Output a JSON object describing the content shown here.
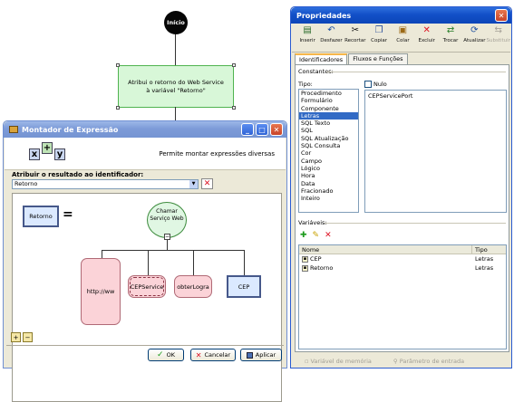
{
  "flow": {
    "start_label": "Início",
    "box_text": "Atribui o retorno do Web Service à variável \"Retorno\""
  },
  "expr_window": {
    "title": "Montador de Expressão",
    "header_text": "Permite montar expressões diversas",
    "assign_label": "Atribuir o resultado ao identificador:",
    "identifier_value": "Retorno",
    "target_label": "Retorno",
    "call_node_label": "Chamar Serviço Web",
    "params": [
      "http://ww",
      "CEPService",
      "obterLogra",
      "CEP"
    ],
    "buttons": {
      "ok": "OK",
      "cancel": "Cancelar",
      "apply": "Aplicar"
    }
  },
  "props_window": {
    "title": "Propriedades",
    "toolbar": [
      {
        "label": "Inserir",
        "icon": "insert-icon",
        "enabled": true
      },
      {
        "label": "Desfazer",
        "icon": "undo-icon",
        "enabled": true
      },
      {
        "label": "Recortar",
        "icon": "cut-icon",
        "enabled": true
      },
      {
        "label": "Copiar",
        "icon": "copy-icon",
        "enabled": true
      },
      {
        "label": "Colar",
        "icon": "paste-icon",
        "enabled": true
      },
      {
        "label": "Excluir",
        "icon": "delete-icon",
        "enabled": true
      },
      {
        "label": "Trocar",
        "icon": "swap-icon",
        "enabled": true
      },
      {
        "label": "Atualizar",
        "icon": "refresh-icon",
        "enabled": true
      },
      {
        "label": "Substituir",
        "icon": "replace-icon",
        "enabled": false
      }
    ],
    "tabs": [
      "Identificadores",
      "Fluxos e Funções"
    ],
    "constants_label": "Constantes:",
    "type_label": "Tipo:",
    "types": [
      "Procedimento",
      "Formulário",
      "Componente",
      "Letras",
      "SQL Texto",
      "SQL",
      "SQL Atualização",
      "SQL Consulta",
      "Cor",
      "Campo",
      "Lógico",
      "Hora",
      "Data",
      "Fracionado",
      "Inteiro"
    ],
    "selected_type": "Letras",
    "null_label": "Nulo",
    "constant_value": "CEPServicePort",
    "variables_label": "Variáveis:",
    "columns": [
      "Nome",
      "Tipo"
    ],
    "variables": [
      {
        "name": "CEP",
        "type": "Letras"
      },
      {
        "name": "Retorno",
        "type": "Letras"
      }
    ],
    "footer": [
      "Variável de memória",
      "Parâmetro de entrada"
    ]
  },
  "colors": {
    "title_blue": "#0b45b8",
    "flow_box_fill": "#d8f7d8",
    "param_fill": "#fbd3d8",
    "selection": "#316ac5"
  }
}
